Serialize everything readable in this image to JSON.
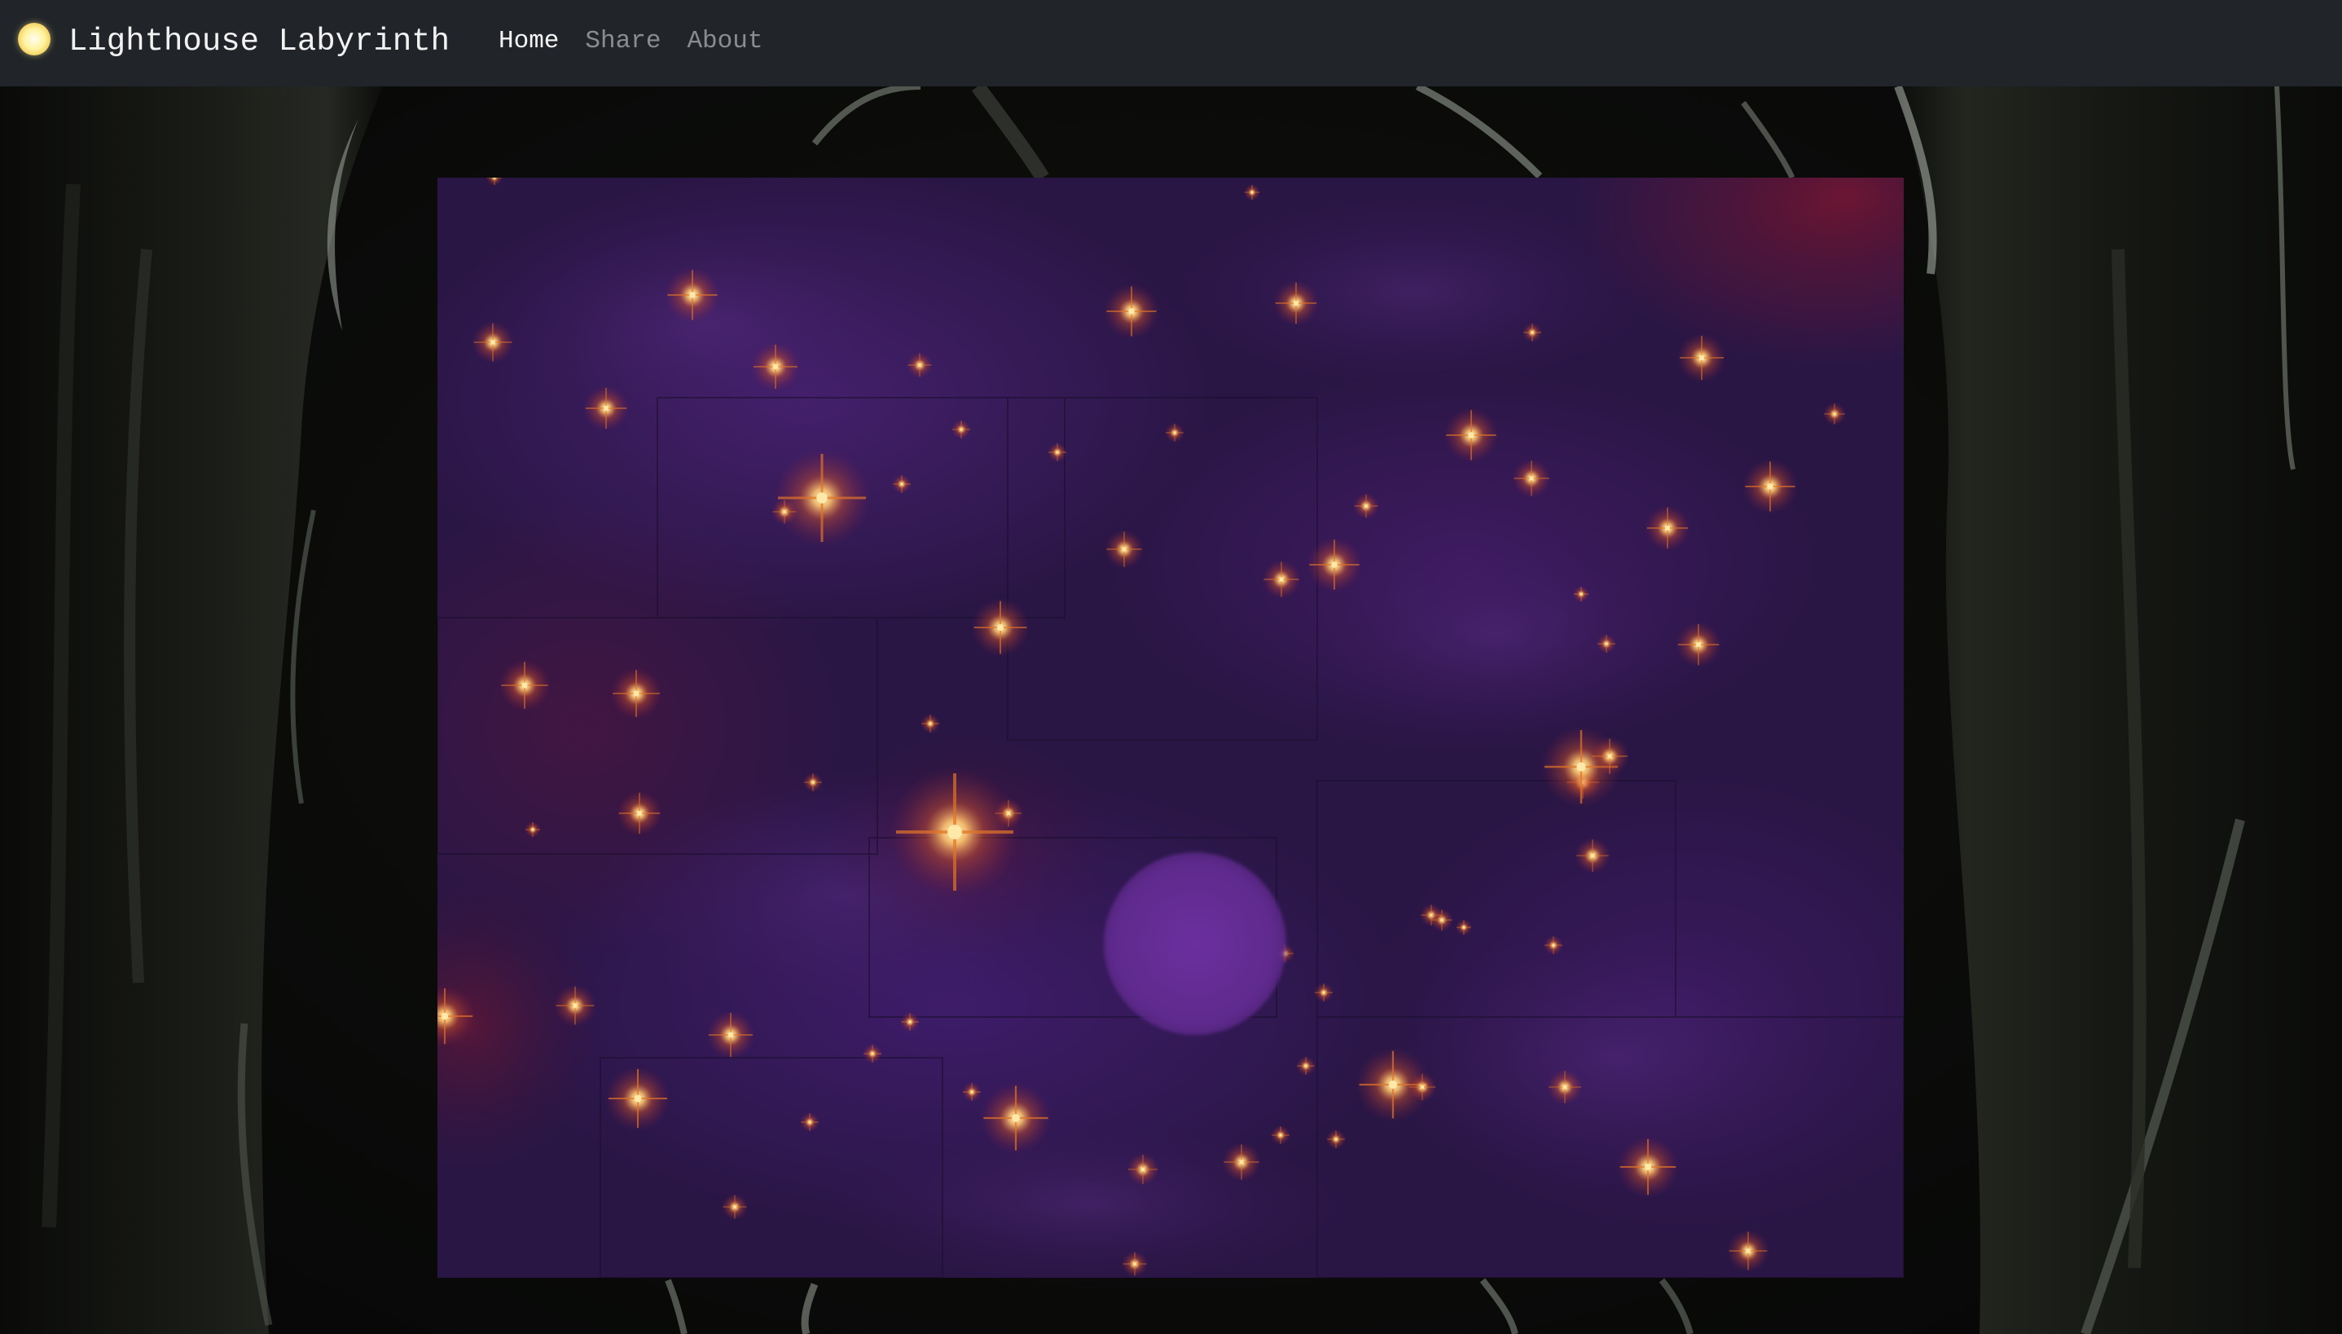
{
  "app": {
    "title": "Lighthouse Labyrinth",
    "brand_icon": "glowing-orb-icon"
  },
  "nav": {
    "links": [
      {
        "label": "Home",
        "active": true
      },
      {
        "label": "Share",
        "active": false
      },
      {
        "label": "About",
        "active": false
      }
    ]
  },
  "colors": {
    "navbar_bg": "#212529",
    "nav_active": "#f4f4f4",
    "nav_inactive": "#8a8d90",
    "canvas_base": "#2a1645",
    "player_orb": "#5f2a8d",
    "star_core": "#ffe9a8",
    "star_glow": "#e0742a"
  },
  "game": {
    "scene": "starfield maze",
    "player": "purple orb"
  }
}
